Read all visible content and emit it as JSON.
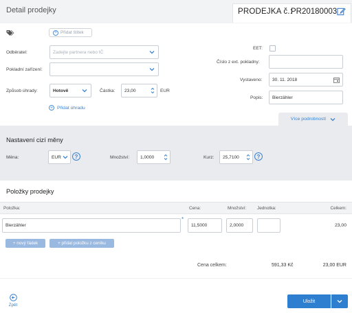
{
  "header": {
    "title": "Detail prodejky",
    "doc_label": "PRODEJKA č.:",
    "doc_number": "PR20180003"
  },
  "form": {
    "add_tag_label": "Přidat štítek",
    "customer_label": "Odběratel:",
    "customer_placeholder": "Zadejte partnera nebo IČ",
    "register_label": "Pokladní zařízení:",
    "register_value": "",
    "payment_method_label": "Způsob úhrady:",
    "payment_method_value": "Hotově",
    "amount_label": "Částka:",
    "amount_value": "23,00",
    "amount_currency": "EUR",
    "add_payment_label": "Přidat úhradu",
    "eet_label": "EET:",
    "ext_register_label": "Číslo z ext. pokladny:",
    "ext_register_value": "",
    "issued_label": "Vystaveno:",
    "issued_value": "30. 11. 2018",
    "description_label": "Popis:",
    "description_value": "Bierzähler",
    "more_details_label": "Více podrobností"
  },
  "foreign_currency": {
    "title": "Nastavení cizí měny",
    "currency_label": "Měna:",
    "currency_value": "EUR",
    "quantity_label": "Množství:",
    "quantity_value": "1,0000",
    "rate_label": "Kurz:",
    "rate_value": "25,7100"
  },
  "items": {
    "title": "Položky prodejky",
    "columns": {
      "item": "Položka:",
      "price": "Cena:",
      "quantity": "Množství:",
      "unit": "Jednotka:",
      "total": "Celkem:"
    },
    "rows": [
      {
        "item": "Bierzähler",
        "price": "11,5000",
        "quantity": "2,0000",
        "unit": "",
        "total": "23,00"
      }
    ],
    "new_row_label": "+ nový řádek",
    "add_from_pricelist_label": "+ přidat položku z ceníku",
    "grand_total_label": "Cena celkem:",
    "grand_total_czk": "591,33 Kč",
    "grand_total_eur": "23,00 EUR"
  },
  "footer": {
    "back_label": "Zpět",
    "save_label": "Uložit"
  },
  "colors": {
    "accent": "#2f7fd0",
    "link": "#3b82d0",
    "panel": "#e9ebef"
  }
}
